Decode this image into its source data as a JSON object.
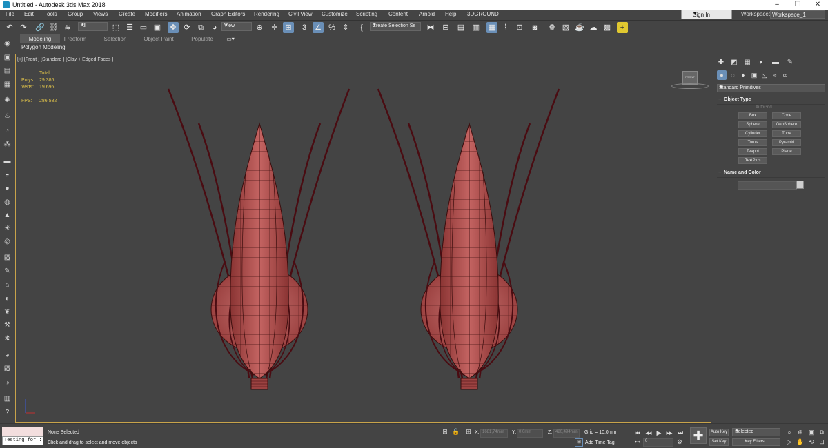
{
  "window": {
    "title": "Untitled - Autodesk 3ds Max 2018",
    "minimize": "–",
    "restore": "❐",
    "close": "✕"
  },
  "menu": {
    "items": [
      "File",
      "Edit",
      "Tools",
      "Group",
      "Views",
      "Create",
      "Modifiers",
      "Animation",
      "Graph Editors",
      "Rendering",
      "Civil View",
      "Customize",
      "Scripting",
      "Content",
      "Arnold",
      "Help",
      "3DGROUND"
    ],
    "sign_in": "Sign In",
    "workspaces_label": "Workspaces:",
    "workspace": "Workspace_1"
  },
  "toolbar": {
    "selection_filter": "All",
    "reference_coord": "View",
    "named_selection": "Create Selection Se",
    "snap_label": "3"
  },
  "ribbon": {
    "tabs": [
      "Modeling",
      "Freeform",
      "Selection",
      "Object Paint",
      "Populate"
    ],
    "active_tab": "Modeling",
    "sub": "Polygon Modeling"
  },
  "viewport": {
    "label": "[+] [Front ] [Standard ] [Clay + Edged Faces ]",
    "stats": {
      "total_label": "Total",
      "polys_label": "Polys:",
      "polys": "29 386",
      "verts_label": "Verts:",
      "verts": "19 696",
      "fps_label": "FPS:",
      "fps": "286,582"
    },
    "viewcube_label": "FRONT",
    "colors": {
      "model_fill": "#b0504f",
      "model_wire": "#3a0d0d",
      "stem": "#4a0c12",
      "border": "#c8a34a"
    }
  },
  "command_panel": {
    "category": "Standard Primitives",
    "object_type_title": "Object Type",
    "autogrid": "AutoGrid",
    "buttons": [
      "Box",
      "Cone",
      "Sphere",
      "GeoSphere",
      "Cylinder",
      "Tube",
      "Torus",
      "Pyramid",
      "Teapot",
      "Plane",
      "TextPlus"
    ],
    "name_color_title": "Name and Color"
  },
  "status": {
    "listener": "Testing for :",
    "selected": "None Selected",
    "prompt": "Click and drag to select and move objects",
    "x_label": "X:",
    "x_value": "1681,74mm",
    "y_label": "Y:",
    "y_value": "0,0mm",
    "z_label": "Z:",
    "z_value": "420,494mm",
    "grid": "Grid = 10,0mm",
    "add_time_tag": "Add Time Tag",
    "auto_key": "Auto Key",
    "selected_dd": "Selected",
    "set_key": "Set Key",
    "key_filters": "Key Filters...",
    "frame": "0"
  }
}
